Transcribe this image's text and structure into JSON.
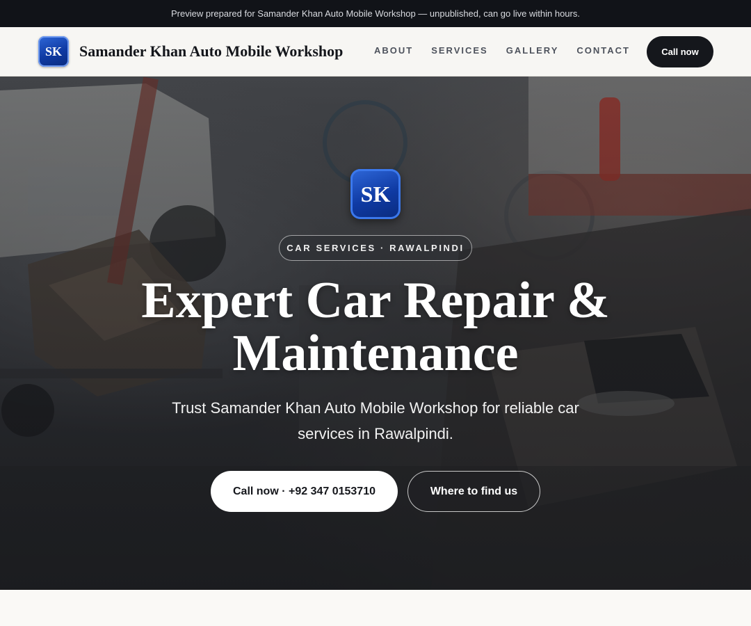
{
  "preview_banner": "Preview prepared for Samander Khan Auto Mobile Workshop — unpublished, can go live within hours.",
  "header": {
    "logo_initials": "SK",
    "brand_name": "Samander Khan Auto Mobile Workshop",
    "nav": [
      "ABOUT",
      "SERVICES",
      "GALLERY",
      "CONTACT"
    ],
    "call_button": "Call now"
  },
  "hero": {
    "logo_initials": "SK",
    "eyebrow": "CAR SERVICES · RAWALPINDI",
    "title_line1": "Expert Car Repair &",
    "title_line2": "Maintenance",
    "subtitle": "Trust Samander Khan Auto Mobile Workshop for reliable car services in Rawalpindi.",
    "primary_button": "Call now · +92 347 0153710",
    "secondary_button": "Where to find us",
    "background_image": "workshop-interior-with-engines"
  },
  "colors": {
    "brand_blue": "#0f3aa3",
    "dark": "#15171c",
    "preview_bar": "#111318"
  }
}
